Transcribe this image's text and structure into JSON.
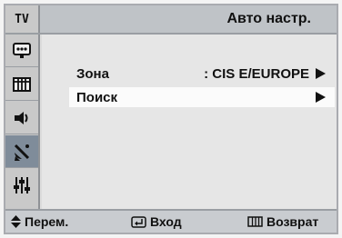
{
  "header": {
    "source_tag": "TV",
    "title": "Авто настр."
  },
  "sidebar": {
    "items": [
      {
        "icon": "picture-icon"
      },
      {
        "icon": "channel-grid-icon"
      },
      {
        "icon": "speaker-icon"
      },
      {
        "icon": "satellite-dish-icon",
        "active": true
      },
      {
        "icon": "equalizer-sliders-icon"
      }
    ]
  },
  "menu": {
    "rows": [
      {
        "label": "Зона",
        "value": ": CIS E/EUROPE",
        "selected": false
      },
      {
        "label": "Поиск",
        "value": "",
        "selected": true
      }
    ]
  },
  "footer": {
    "move_label": "Перем.",
    "enter_label": "Вход",
    "return_label": "Возврат"
  },
  "colors": {
    "frame": "#a9abb0",
    "header_bg": "#bfc3c7",
    "sidebar_active": "#7f8c9a",
    "selected_row": "#fbfbfb"
  }
}
